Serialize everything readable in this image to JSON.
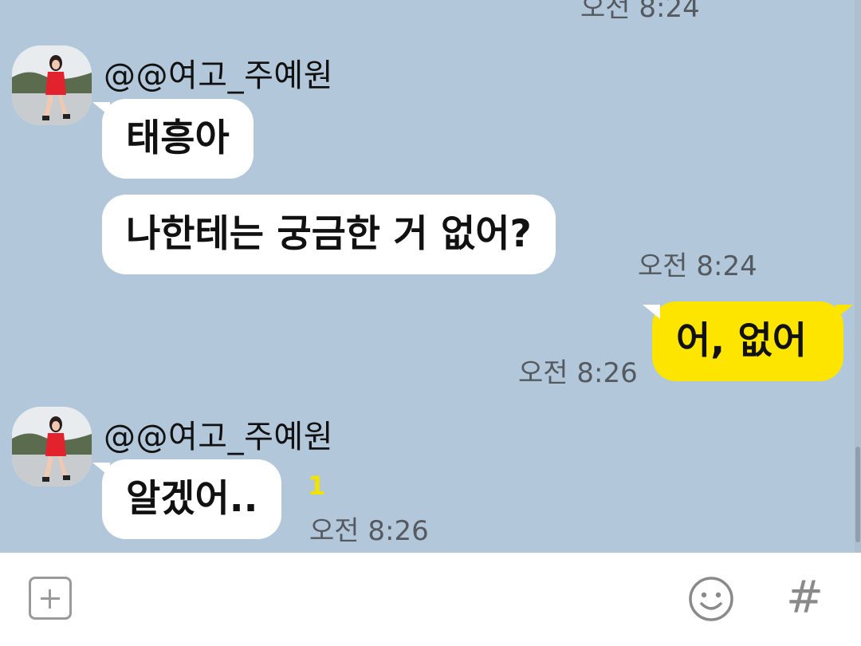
{
  "messages": {
    "prev_time": "오전 8:24",
    "group1": {
      "sender": "@@여고_주예원",
      "bubble1": "태흥아",
      "bubble2": "나한테는 궁금한 거 없어?",
      "time": "오전 8:24"
    },
    "mine": {
      "text": "어, 없어",
      "time": "오전 8:26"
    },
    "group2": {
      "sender": "@@여고_주예원",
      "bubble1": "알겠어..",
      "unread": "1",
      "time": "오전 8:26"
    }
  },
  "input_bar": {
    "add_icon": "plus-square-icon",
    "emoji_icon": "smile-icon",
    "hash_label": "#"
  },
  "colors": {
    "chat_background": "#b2c7d9",
    "my_bubble": "#fee500",
    "other_bubble": "#ffffff",
    "unread_count": "#f2e200"
  }
}
